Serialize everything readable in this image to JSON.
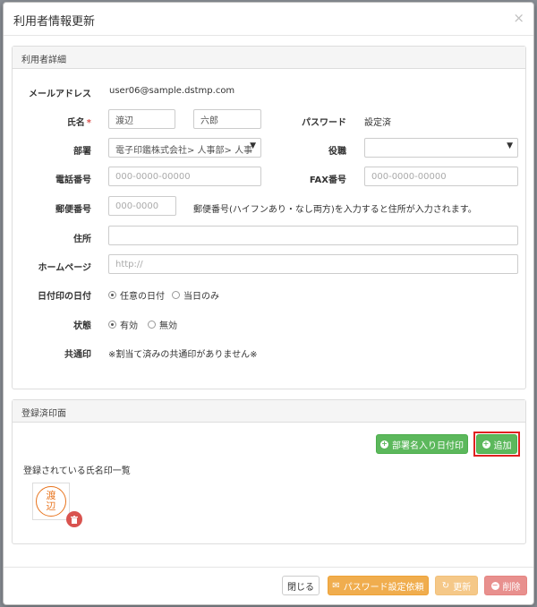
{
  "modal": {
    "title": "利用者情報更新",
    "close": "×"
  },
  "details": {
    "heading": "利用者詳細",
    "email": {
      "label": "メールアドレス",
      "value": "user06@sample.dstmp.com"
    },
    "name": {
      "label": "氏名",
      "required": "*",
      "last": "渡辺",
      "first": "六郎"
    },
    "password": {
      "label": "パスワード",
      "value": "設定済"
    },
    "department": {
      "label": "部署",
      "value": "電子印鑑株式会社> 人事部> 人事"
    },
    "position": {
      "label": "役職",
      "value": ""
    },
    "phone": {
      "label": "電話番号",
      "placeholder": "000-0000-00000"
    },
    "fax": {
      "label": "FAX番号",
      "placeholder": "000-0000-00000"
    },
    "postal": {
      "label": "郵便番号",
      "placeholder": "000-0000",
      "hint": "郵便番号(ハイフンあり・なし両方)を入力すると住所が入力されます。"
    },
    "address": {
      "label": "住所",
      "value": ""
    },
    "homepage": {
      "label": "ホームページ",
      "placeholder": "http://"
    },
    "date_stamp": {
      "label": "日付印の日付",
      "options": [
        "任意の日付",
        "当日のみ"
      ],
      "selected": "任意の日付"
    },
    "status": {
      "label": "状態",
      "options": [
        "有効",
        "無効"
      ],
      "selected": "有効"
    },
    "common_stamp": {
      "label": "共通印",
      "value": "※割当て済みの共通印がありません※"
    }
  },
  "stamps": {
    "heading": "登録済印面",
    "dept_date_button": "部署名入り日付印",
    "add_button": "追加",
    "list_label": "登録されている氏名印一覧",
    "stamp_text": [
      "渡",
      "辺"
    ],
    "colors": {
      "stamp": "#e8731c",
      "delete": "#d9534f",
      "highlight": "#e02020"
    }
  },
  "footer": {
    "close": "閉じる",
    "password_request": "パスワード設定依頼",
    "update": "更新",
    "delete": "削除"
  }
}
